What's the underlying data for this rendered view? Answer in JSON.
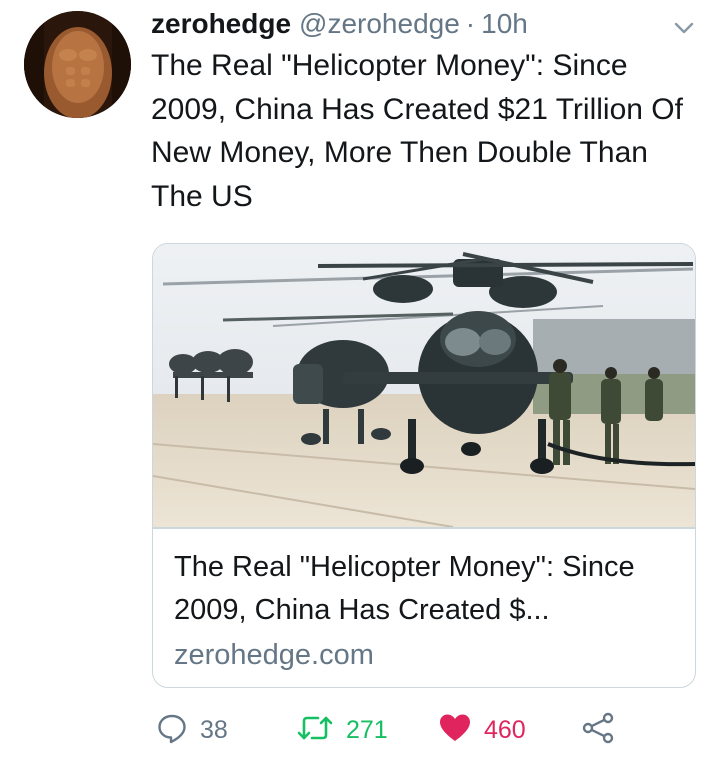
{
  "author": {
    "display_name": "zerohedge",
    "handle": "@zerohedge",
    "separator": "·",
    "time": "10h"
  },
  "tweet": {
    "text": "The Real \"Helicopter Money\": Since 2009, China Has Created $21 Trillion Of New Money, More Then Double Than The US"
  },
  "card": {
    "title": "The Real \"Helicopter Money\": Since 2009, China Has Created $...",
    "domain": "zerohedge.com"
  },
  "actions": {
    "replies": "38",
    "retweets": "271",
    "likes": "460"
  },
  "colors": {
    "text_primary": "#14171a",
    "text_secondary": "#657786",
    "border": "#ccd6dd",
    "retweet_green": "#17bf63",
    "like_red": "#e0245e"
  },
  "icons": {
    "reply": "speech-bubble-icon",
    "retweet": "retweet-arrows-icon",
    "like": "heart-filled-icon",
    "share": "share-nodes-icon",
    "menu": "chevron-down-icon"
  }
}
